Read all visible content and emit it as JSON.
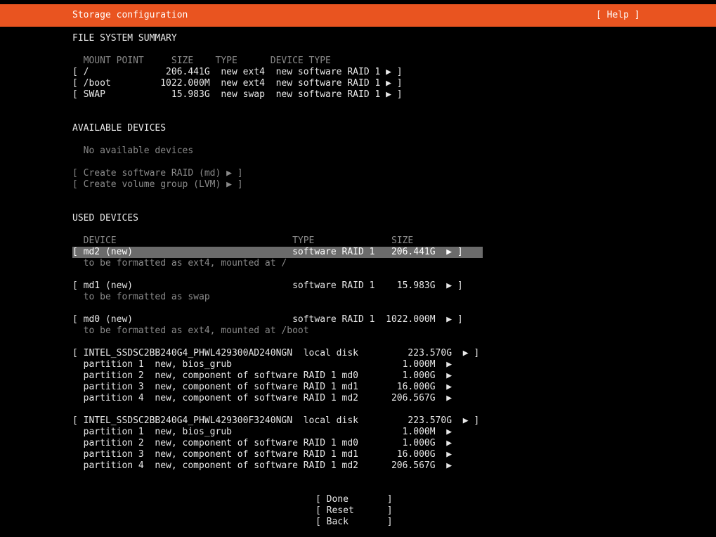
{
  "header": {
    "title": "Storage configuration",
    "help_button": "[ Help ]"
  },
  "colors": {
    "accent": "#e95420",
    "background": "#000000",
    "selected_row": "#6b6b6b",
    "dim_text": "#8a8a8a"
  },
  "fs_summary": {
    "heading": "FILE SYSTEM SUMMARY",
    "columns": "  MOUNT POINT     SIZE    TYPE      DEVICE TYPE",
    "rows": [
      "[ /              206.441G  new ext4  new software RAID 1 ▶ ]",
      "[ /boot         1022.000M  new ext4  new software RAID 1 ▶ ]",
      "[ SWAP            15.983G  new swap  new software RAID 1 ▶ ]"
    ]
  },
  "available": {
    "heading": "AVAILABLE DEVICES",
    "empty_text": "  No available devices",
    "actions": [
      "[ Create software RAID (md) ▶ ]",
      "[ Create volume group (LVM) ▶ ]"
    ]
  },
  "used": {
    "heading": "USED DEVICES",
    "columns": "  DEVICE                                TYPE              SIZE",
    "md2": {
      "row": "[ md2 (new)                             software RAID 1   206.441G  ▶ ]",
      "sub": "  to be formatted as ext4, mounted at /"
    },
    "md1": {
      "row": "[ md1 (new)                             software RAID 1    15.983G  ▶ ]",
      "sub": "  to be formatted as swap"
    },
    "md0": {
      "row": "[ md0 (new)                             software RAID 1  1022.000M  ▶ ]",
      "sub": "  to be formatted as ext4, mounted at /boot"
    },
    "disk1": {
      "row": "[ INTEL_SSDSC2BB240G4_PHWL429300AD240NGN  local disk         223.570G  ▶ ]",
      "partitions": [
        "  partition 1  new, bios_grub                               1.000M  ▶",
        "  partition 2  new, component of software RAID 1 md0        1.000G  ▶",
        "  partition 3  new, component of software RAID 1 md1       16.000G  ▶",
        "  partition 4  new, component of software RAID 1 md2      206.567G  ▶"
      ]
    },
    "disk2": {
      "row": "[ INTEL_SSDSC2BB240G4_PHWL429300F3240NGN  local disk         223.570G  ▶ ]",
      "partitions": [
        "  partition 1  new, bios_grub                               1.000M  ▶",
        "  partition 2  new, component of software RAID 1 md0        1.000G  ▶",
        "  partition 3  new, component of software RAID 1 md1       16.000G  ▶",
        "  partition 4  new, component of software RAID 1 md2      206.567G  ▶"
      ]
    }
  },
  "buttons": {
    "done": "[ Done       ]",
    "reset": "[ Reset      ]",
    "back": "[ Back       ]"
  }
}
